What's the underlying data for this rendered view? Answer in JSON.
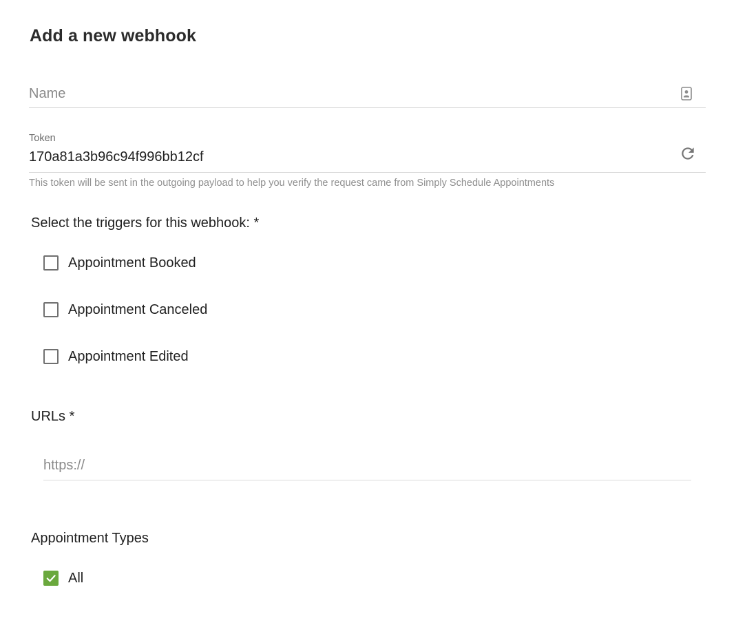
{
  "title": "Add a new webhook",
  "name_field": {
    "placeholder": "Name",
    "value": "",
    "icon": "contact-card-icon"
  },
  "token_field": {
    "label": "Token",
    "value": "170a81a3b96c94f996bb12cf",
    "icon": "refresh-icon",
    "hint": "This token will be sent in the outgoing payload to help you verify the request came from Simply Schedule Appointments"
  },
  "triggers": {
    "label": "Select the triggers for this webhook: *",
    "options": [
      {
        "label": "Appointment Booked",
        "checked": false
      },
      {
        "label": "Appointment Canceled",
        "checked": false
      },
      {
        "label": "Appointment Edited",
        "checked": false
      }
    ]
  },
  "urls": {
    "label": "URLs *",
    "placeholder": "https://",
    "value": ""
  },
  "appointment_types": {
    "label": "Appointment Types",
    "options": [
      {
        "label": "All",
        "checked": true
      }
    ]
  },
  "colors": {
    "accent": "#6aa83d",
    "divider": "#d9d9d9",
    "hint_text": "#8f8f8f"
  }
}
